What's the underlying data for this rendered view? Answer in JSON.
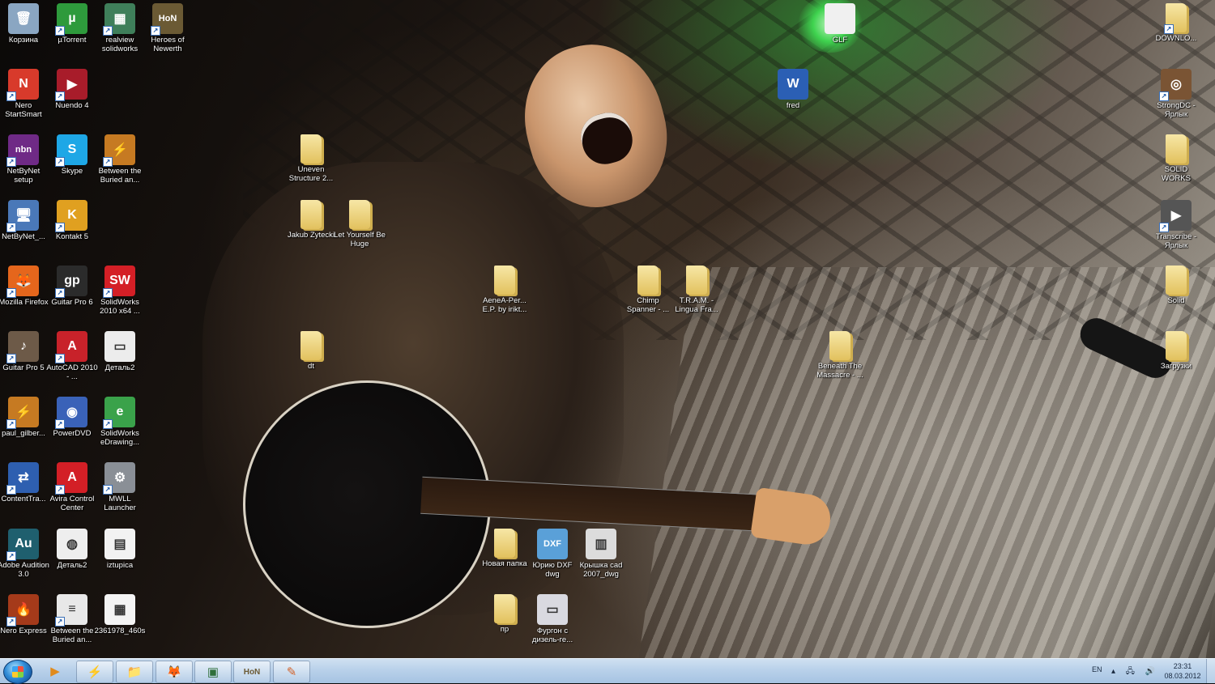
{
  "desktop": {
    "icons": [
      {
        "label": "Корзина",
        "glyph": "🗑",
        "color": "#8aa6c2",
        "shortcut": false
      },
      {
        "label": "µTorrent",
        "glyph": "µ",
        "color": "#2e9a3c",
        "shortcut": true
      },
      {
        "label": "realview solidworks",
        "glyph": "▦",
        "color": "#3f7f5a",
        "shortcut": true
      },
      {
        "label": "Heroes of Newerth",
        "glyph": "HoN",
        "color": "#6b5a34",
        "shortcut": true
      },
      {
        "label": "DOWNLO...",
        "glyph": "",
        "color": "",
        "shortcut": true
      },
      {
        "label": "Nero StartSmart",
        "glyph": "N",
        "color": "#d83a2b",
        "shortcut": true
      },
      {
        "label": "Nuendo 4",
        "glyph": "▶",
        "color": "#a81c2a",
        "shortcut": true
      },
      {
        "label": "fred",
        "glyph": "W",
        "color": "#2b5fb4",
        "shortcut": false
      },
      {
        "label": "StrongDC - Ярлык",
        "glyph": "◎",
        "color": "#7a5434",
        "shortcut": true
      },
      {
        "label": "NetByNet setup",
        "glyph": "nbn",
        "color": "#6f2a86",
        "shortcut": true
      },
      {
        "label": "Skype",
        "glyph": "S",
        "color": "#1ea7e6",
        "shortcut": true
      },
      {
        "label": "Between the Buried an...",
        "glyph": "⚡",
        "color": "#c67a22",
        "shortcut": true
      },
      {
        "label": "Uneven Structure 2...",
        "glyph": "",
        "color": "",
        "shortcut": false
      },
      {
        "label": "SOLID WORKS",
        "glyph": "",
        "color": "",
        "shortcut": false
      },
      {
        "label": "NetByNet_...",
        "glyph": "🖥",
        "color": "#4a78b8",
        "shortcut": true
      },
      {
        "label": "Kontakt 5",
        "glyph": "K",
        "color": "#e0a020",
        "shortcut": true
      },
      {
        "label": "Jakub Zytecki",
        "glyph": "",
        "color": "",
        "shortcut": false
      },
      {
        "label": "Let Yourself Be Huge",
        "glyph": "",
        "color": "",
        "shortcut": false
      },
      {
        "label": "Transcribe - Ярлык",
        "glyph": "▶",
        "color": "#555555",
        "shortcut": true
      },
      {
        "label": "Mozilla Firefox",
        "glyph": "🦊",
        "color": "#e5661c",
        "shortcut": true
      },
      {
        "label": "Guitar Pro 6",
        "glyph": "gp",
        "color": "#2b2b2b",
        "shortcut": true
      },
      {
        "label": "SolidWorks 2010 x64 ...",
        "glyph": "SW",
        "color": "#d41f26",
        "shortcut": true
      },
      {
        "label": "AeneA-Per... E.P. by irikt...",
        "glyph": "",
        "color": "",
        "shortcut": false
      },
      {
        "label": "Chimp Spanner - ...",
        "glyph": "",
        "color": "",
        "shortcut": false
      },
      {
        "label": "T.R.A.M. - Lingua Fra...",
        "glyph": "",
        "color": "",
        "shortcut": false
      },
      {
        "label": "Solid",
        "glyph": "",
        "color": "",
        "shortcut": false
      },
      {
        "label": "Guitar Pro 5",
        "glyph": "♪",
        "color": "#6d5a48",
        "shortcut": true
      },
      {
        "label": "AutoCAD 2010 - ...",
        "glyph": "A",
        "color": "#c8222a",
        "shortcut": true
      },
      {
        "label": "Деталь2",
        "glyph": "▭",
        "color": "#ececec",
        "shortcut": false
      },
      {
        "label": "dt",
        "glyph": "",
        "color": "",
        "shortcut": false
      },
      {
        "label": "Beneath The Massacre - ...",
        "glyph": "",
        "color": "",
        "shortcut": false
      },
      {
        "label": "Загрузки",
        "glyph": "",
        "color": "",
        "shortcut": false
      },
      {
        "label": "paul_gilber...",
        "glyph": "⚡",
        "color": "#c67a22",
        "shortcut": true
      },
      {
        "label": "PowerDVD",
        "glyph": "◉",
        "color": "#3a62b8",
        "shortcut": true
      },
      {
        "label": "SolidWorks eDrawing...",
        "glyph": "e",
        "color": "#3aa24a",
        "shortcut": true
      },
      {
        "label": "ContentTra...",
        "glyph": "⇄",
        "color": "#2e5fb0",
        "shortcut": true
      },
      {
        "label": "Avira Control Center",
        "glyph": "A",
        "color": "#d31f26",
        "shortcut": true
      },
      {
        "label": "MWLL Launcher",
        "glyph": "⚙",
        "color": "#8a8f96",
        "shortcut": true
      },
      {
        "label": "Adobe Audition 3.0",
        "glyph": "Au",
        "color": "#1f5f6e",
        "shortcut": true
      },
      {
        "label": "Деталь2",
        "glyph": "◍",
        "color": "#eeeeee",
        "shortcut": false
      },
      {
        "label": "iztupica",
        "glyph": "▤",
        "color": "#f2f2f2",
        "shortcut": false
      },
      {
        "label": "Новая папка",
        "glyph": "",
        "color": "",
        "shortcut": false
      },
      {
        "label": "Юрию DXF dwg",
        "glyph": "DXF",
        "color": "#5aa0d8",
        "shortcut": false
      },
      {
        "label": "Крышка cad 2007_dwg",
        "glyph": "▥",
        "color": "#dcdcdc",
        "shortcut": false
      },
      {
        "label": "Nero Express",
        "glyph": "🔥",
        "color": "#a53a1a",
        "shortcut": true
      },
      {
        "label": "Between the Buried an...",
        "glyph": "≡",
        "color": "#e8e8e8",
        "shortcut": true
      },
      {
        "label": "2361978_460s",
        "glyph": "▦",
        "color": "#f4f4f4",
        "shortcut": false
      },
      {
        "label": "пр",
        "glyph": "",
        "color": "",
        "shortcut": false
      },
      {
        "label": "Фургон с дизель-ге...",
        "glyph": "▭",
        "color": "#d9d9e0",
        "shortcut": false
      },
      {
        "label": "GLF",
        "glyph": "",
        "color": "#f0f0f0",
        "shortcut": false
      }
    ]
  },
  "taskbar": {
    "start_icon": "windows-start-orb",
    "pinned": [
      {
        "name": "media-player",
        "glyph": "▶",
        "color": "#e08a1c",
        "active": false
      },
      {
        "name": "lightning-app",
        "glyph": "⚡",
        "color": "#c67a22",
        "active": true
      },
      {
        "name": "explorer",
        "glyph": "📁",
        "color": "#e6c15c",
        "active": true
      },
      {
        "name": "firefox",
        "glyph": "🦊",
        "color": "#e5661c",
        "active": true
      },
      {
        "name": "terminal-app",
        "glyph": "▣",
        "color": "#2f6f3a",
        "active": true
      },
      {
        "name": "heroes-of-newerth",
        "glyph": "HoN",
        "color": "#6b5a34",
        "active": true
      },
      {
        "name": "paint-app",
        "glyph": "✎",
        "color": "#d2622a",
        "active": true
      }
    ],
    "tray": {
      "language": "EN",
      "icons": "▴ 🖧 🔊",
      "time": "23:31",
      "date": "08.03.2012"
    }
  }
}
